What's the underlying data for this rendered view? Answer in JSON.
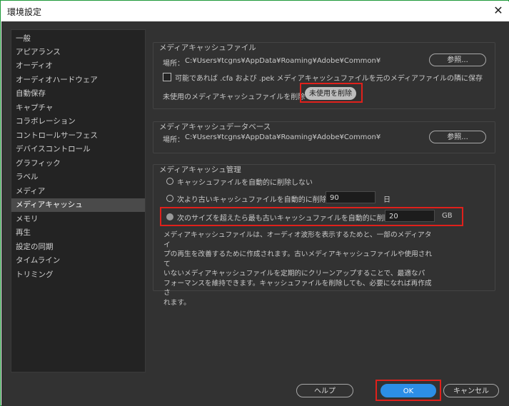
{
  "window": {
    "title": "環境設定",
    "close_glyph": "✕"
  },
  "sidebar": {
    "items": [
      {
        "label": "一般"
      },
      {
        "label": "アピアランス"
      },
      {
        "label": "オーディオ"
      },
      {
        "label": "オーディオハードウェア"
      },
      {
        "label": "自動保存"
      },
      {
        "label": "キャプチャ"
      },
      {
        "label": "コラボレーション"
      },
      {
        "label": "コントロールサーフェス"
      },
      {
        "label": "デバイスコントロール"
      },
      {
        "label": "グラフィック"
      },
      {
        "label": "ラベル"
      },
      {
        "label": "メディア"
      },
      {
        "label": "メディアキャッシュ",
        "selected": true
      },
      {
        "label": "メモリ"
      },
      {
        "label": "再生"
      },
      {
        "label": "設定の同期"
      },
      {
        "label": "タイムライン"
      },
      {
        "label": "トリミング"
      }
    ]
  },
  "cache_files": {
    "title": "メディアキャッシュファイル",
    "location_label": "場所：",
    "location_path": "C:¥Users¥tcgns¥AppData¥Roaming¥Adobe¥Common¥",
    "browse_button": "参照...",
    "save_next_to_originals": {
      "label": "可能であれば .cfa および .pek メディアキャッシュファイルを元のメディアファイルの隣に保存",
      "checked": false
    },
    "remove_unused_label": "未使用のメディアキャッシュファイルを削除",
    "remove_unused_button": "未使用を削除"
  },
  "cache_db": {
    "title": "メディアキャッシュデータベース",
    "location_label": "場所：",
    "location_path": "C:¥Users¥tcgns¥AppData¥Roaming¥Adobe¥Common¥",
    "browse_button": "参照..."
  },
  "cache_management": {
    "title": "メディアキャッシュ管理",
    "option_never": "キャッシュファイルを自動的に削除しない",
    "option_days": "次より古いキャッシュファイルを自動的に削除：",
    "days_value": "90",
    "days_unit": "日",
    "option_size": "次のサイズを超えたら最も古いキャッシュファイルを自動的に削除：",
    "size_value": "20",
    "size_unit": "GB",
    "selected_option": "size",
    "description_lines": [
      "メディアキャッシュファイルは、オーディオ波形を表示するためと、一部のメディアタイ",
      "プの再生を改善するために作成されます。古いメディアキャッシュファイルや使用されて",
      "いないメディアキャッシュファイルを定期的にクリーンアップすることで、最適なパ",
      "フォーマンスを維持できます。キャッシュファイルを削除しても、必要になれば再作成さ",
      "れます。"
    ]
  },
  "footer": {
    "help_button": "ヘルプ",
    "ok_button": "OK",
    "cancel_button": "キャンセル"
  },
  "colors": {
    "dialog_bg": "#323232",
    "list_bg": "#232323",
    "accent_blue": "#2c8ee6",
    "highlight_red": "#e0201b"
  }
}
